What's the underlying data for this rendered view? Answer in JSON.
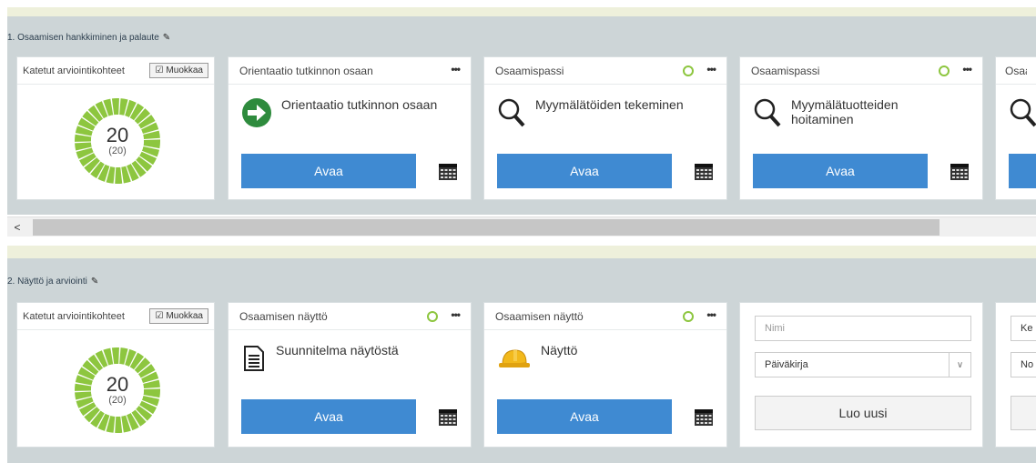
{
  "section1": {
    "title": "1. Osaamisen hankkiminen ja palaute",
    "counter": {
      "label": "Katetut arviointikohteet",
      "edit_label": "Muokkaa",
      "value": "20",
      "sub": "(20)"
    },
    "cards": [
      {
        "header": "Orientaatio tutkinnon osaan",
        "item": "Orientaatio tutkinnon osaan",
        "icon": "green-arrow-icon",
        "button": "Avaa",
        "status": false
      },
      {
        "header": "Osaamispassi",
        "item": "Myymälätöiden tekeminen",
        "icon": "magnifier-icon",
        "button": "Avaa",
        "status": true
      },
      {
        "header": "Osaamispassi",
        "item": "Myymälätuotteiden hoitaminen",
        "icon": "magnifier-icon",
        "button": "Avaa",
        "status": true
      },
      {
        "header": "Osaan",
        "icon": "magnifier-icon"
      }
    ]
  },
  "section2": {
    "title": "2. Näyttö ja arviointi",
    "counter": {
      "label": "Katetut arviointikohteet",
      "edit_label": "Muokkaa",
      "value": "20",
      "sub": "(20)"
    },
    "cards": [
      {
        "header": "Osaamisen näyttö",
        "item": "Suunnitelma näytöstä",
        "icon": "document-icon",
        "button": "Avaa",
        "status": true
      },
      {
        "header": "Osaamisen näyttö",
        "item": "Näyttö",
        "icon": "hardhat-icon",
        "button": "Avaa",
        "status": true
      }
    ],
    "form": {
      "name_placeholder": "Nimi",
      "type_value": "Päiväkirja",
      "create_label": "Luo uusi"
    },
    "form2": {
      "field1": "Ke",
      "field2": "No"
    }
  },
  "scrollbar": {
    "left_arrow": "<"
  },
  "colors": {
    "band": "#cdd5d7",
    "accent_button": "#3f8ad2",
    "status_green": "#8dc63f",
    "donut_green": "#8dc63f"
  }
}
